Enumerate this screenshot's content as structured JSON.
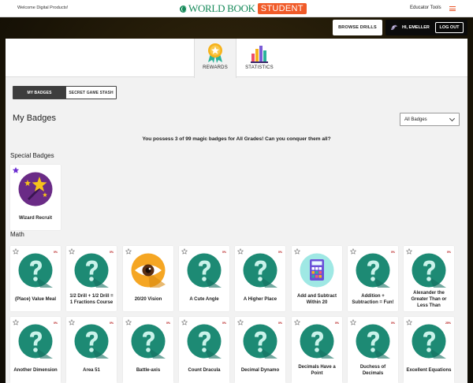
{
  "header": {
    "welcome": "Welcome Digital Products!",
    "logo_main": "WORLD BOOK",
    "logo_badge": "STUDENT",
    "educator_tools": "Educator Tools"
  },
  "toolbar": {
    "browse_drills": "BROWSE DRILLS",
    "greeting": "HI, EMELLER",
    "logout": "LOG OUT"
  },
  "tabs": {
    "rewards": "REWARDS",
    "statistics": "STATISTICS"
  },
  "segments": {
    "my_badges": "MY BADGES",
    "secret_stash": "SECRET GAME STASH"
  },
  "page_title": "My Badges",
  "filter": {
    "selected": "All Badges"
  },
  "summary": "You possess 3 of 99 magic badges for All Grades! Can you conquer them all?",
  "sections": {
    "special": "Special Badges",
    "math": "Math"
  },
  "special_badges": [
    {
      "name": "Wizard Recruit",
      "earned": true
    }
  ],
  "math_row1": [
    {
      "name": "(Place) Value Meal",
      "pct": "0%"
    },
    {
      "name": "1/2 Drill + 1/2 Drill = 1 Fractions Course",
      "pct": "0%"
    },
    {
      "name": "20/20 Vision",
      "pct": ""
    },
    {
      "name": "A Cute Angle",
      "pct": "0%"
    },
    {
      "name": "A Higher Place",
      "pct": "0%"
    },
    {
      "name": "Add and Subtract Within 20",
      "pct": ""
    },
    {
      "name": "Addition + Subtraction = Fun!",
      "pct": "0%"
    },
    {
      "name": "Alexander the Greater Than or Less Than",
      "pct": "0%"
    }
  ],
  "math_row2": [
    {
      "name": "Another Dimension",
      "pct": "0%"
    },
    {
      "name": "Area 51",
      "pct": "0%"
    },
    {
      "name": "Battle-axis",
      "pct": "0%"
    },
    {
      "name": "Count Dracula",
      "pct": "0%"
    },
    {
      "name": "Decimal Dynamo",
      "pct": "0%"
    },
    {
      "name": "Decimals Have a Point",
      "pct": "0%"
    },
    {
      "name": "Duchess of Decimals",
      "pct": "0%"
    },
    {
      "name": "Excellent Equations",
      "pct": "25%"
    }
  ],
  "colors": {
    "badge_teal": "#1d8a74",
    "question_mark": "#c9f3ea",
    "wizard_purple": "#6a2b86",
    "percent_red": "#b31515",
    "student_orange": "#f05a28",
    "logo_green": "#168a5a"
  }
}
